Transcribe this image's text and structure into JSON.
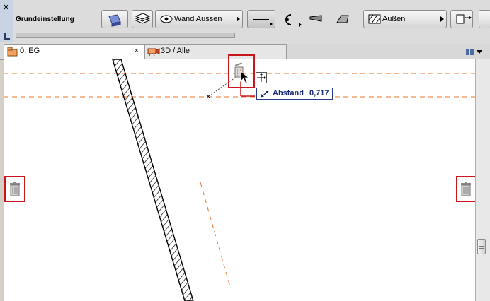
{
  "toolbar": {
    "info_box_title": "Grundeinstellung",
    "layer_button_label": "Wand Aussen",
    "fill_button_label": "Außen"
  },
  "tabs": [
    {
      "label": "0. EG",
      "close": "×"
    },
    {
      "label": "3D / Alle"
    }
  ],
  "tooltip": {
    "label": "Abstand",
    "value": "0,717"
  },
  "colors": {
    "highlight": "#c8161d",
    "guide_line": "#e8742c",
    "tooltip_text": "#1a2a7a"
  },
  "icons": [
    "trash-icon",
    "move-cross-icon",
    "distance-icon",
    "eye-icon"
  ]
}
